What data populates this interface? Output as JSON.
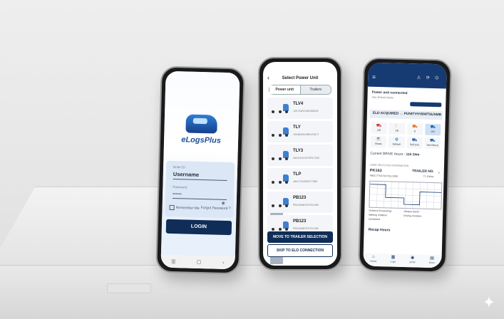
{
  "phone_login": {
    "logo_text": "eLogsPlus",
    "username_label": "Enter ID",
    "username_value": "Username",
    "password_label": "Password",
    "password_value": "••••••",
    "remember_me": "Remember Me",
    "forgot_password": "Forgot Password ?",
    "login_button": "LOGIN",
    "nav": [
      "|||",
      "▢",
      "‹"
    ]
  },
  "phone_units": {
    "back": "‹",
    "title": "Select Power Unit",
    "tabs": [
      "Power unit",
      "Trailers"
    ],
    "units": [
      {
        "name": "TLV4",
        "vin": "1XKYD49X3NJ455224"
      },
      {
        "name": "TLY",
        "vin": "1XKBD49X4NR476477"
      },
      {
        "name": "TLY3",
        "vin": "3AKJHLDV2TDR17238"
      },
      {
        "name": "TLP",
        "vin": "4AKLT1S25DGT7985"
      },
      {
        "name": "PB123",
        "vin": "PB1234567KHTDL096"
      },
      {
        "name": "PB123",
        "vin": "PB1234567KHTDL096"
      }
    ],
    "move_button": "MOVE TO TRAILER SELECTION",
    "skip_button": "SKIP TO ELD CONNECTION"
  },
  "phone_dashboard": {
    "menu": "≡",
    "header_icons": "⚠ ⟳ ⏻",
    "status": "Power unit connected",
    "status_sub": "SN# 3RNWHT8RM",
    "eld_line": "ELD ACQUIRED → PUNITYHYBWTSUSMB",
    "duty_tiles": [
      {
        "label": "Off",
        "icon": "⛟"
      },
      {
        "label": "SB",
        "icon": "☾"
      },
      {
        "label": "D",
        "icon": "⛟"
      },
      {
        "label": "ON",
        "icon": "⛟"
      },
      {
        "label": "Break",
        "icon": "☕"
      },
      {
        "label": "Default",
        "icon": "⚙"
      },
      {
        "label": "Self Use",
        "icon": "⛟"
      },
      {
        "label": "Yard Move",
        "icon": "⛟"
      }
    ],
    "clock_label": "Current DRIVE Hours :",
    "clock_value": "11h 24m",
    "user_selected": "USER SELECTED INFORMATION",
    "pk_label": "PK163",
    "pk_value": "PB0C7TN4T2KYELD09E",
    "trailer_label": "TRAILER NO.",
    "trailer_value": "TL Gallay",
    "chart_rows": [
      "OFF",
      "SB",
      "D",
      "ON"
    ],
    "legend": [
      "Violation Exceedings",
      "Sleeper Berth",
      "Waiting Violation",
      "Driving Violation",
      "Uncleared",
      ""
    ],
    "recap": "Recap Hours",
    "bottom_nav": [
      {
        "icon": "⌂",
        "label": "Home"
      },
      {
        "icon": "▦",
        "label": "Logs"
      },
      {
        "icon": "◉",
        "label": "DVIR"
      },
      {
        "icon": "▤",
        "label": "Docs"
      }
    ]
  }
}
